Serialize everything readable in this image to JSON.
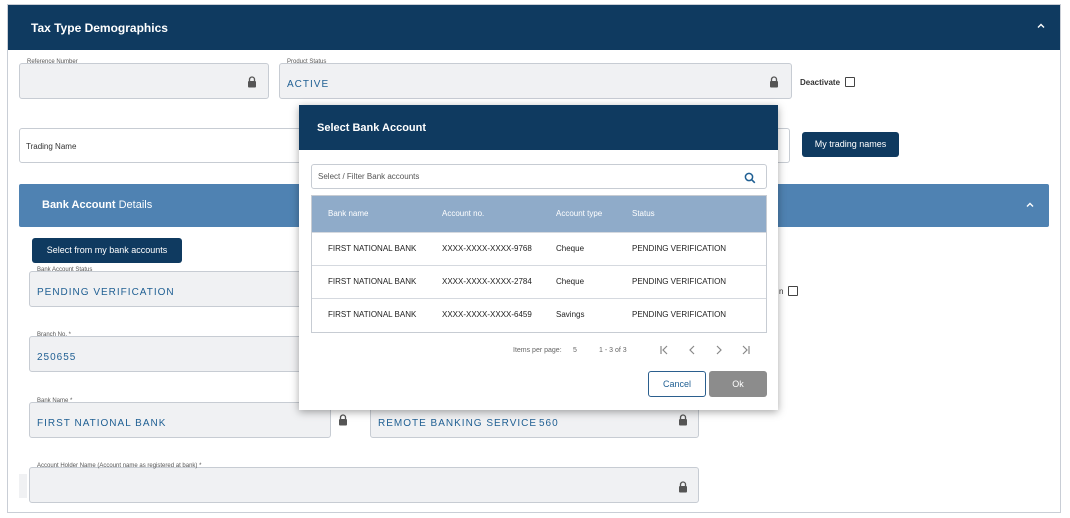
{
  "section": {
    "title": "Tax Type Demographics"
  },
  "reference_number": {
    "label": "Reference Number",
    "value": ""
  },
  "product_status": {
    "label": "Product Status",
    "value": "ACTIVE"
  },
  "deactivate": {
    "label": "Deactivate",
    "checked": false
  },
  "trading_name": {
    "label": "Trading Name"
  },
  "my_trading_names_label": "My trading names",
  "bank_section": {
    "title_bold": "Bank Account",
    "title_rest": " Details"
  },
  "select_bank_button": "Select from my bank accounts",
  "bank_account_status": {
    "label": "Bank Account Status",
    "value": "PENDING VERIFICATION"
  },
  "right_checkbox": {
    "label_fragment": "n",
    "checked": false
  },
  "branch_no": {
    "label": "Branch No. *",
    "value": "250655"
  },
  "bank_name": {
    "label": "Bank Name *",
    "value": "FIRST NATIONAL BANK"
  },
  "branch_name": {
    "value": "REMOTE BANKING SERVICE",
    "code": "560"
  },
  "account_holder": {
    "label": "Account Holder Name (Account name as registered at bank) *",
    "value": ""
  },
  "modal": {
    "title": "Select Bank Account",
    "search_placeholder": "Select / Filter Bank accounts",
    "columns": [
      "Bank name",
      "Account no.",
      "Account type",
      "Status"
    ],
    "rows": [
      {
        "bank": "FIRST NATIONAL BANK",
        "account": "XXXX-XXXX-XXXX-9768",
        "type": "Cheque",
        "status": "PENDING VERIFICATION"
      },
      {
        "bank": "FIRST NATIONAL BANK",
        "account": "XXXX-XXXX-XXXX-2784",
        "type": "Cheque",
        "status": "PENDING VERIFICATION"
      },
      {
        "bank": "FIRST NATIONAL BANK",
        "account": "XXXX-XXXX-XXXX-6459",
        "type": "Savings",
        "status": "PENDING VERIFICATION"
      }
    ],
    "items_per_page_label": "Items per page:",
    "items_per_page": "5",
    "range": "1 - 3 of 3",
    "cancel_label": "Cancel",
    "ok_label": "Ok"
  },
  "colors": {
    "header_dark": "#0f3a60",
    "header_light": "#4f82b2",
    "table_head": "#8fabc9",
    "value_text": "#1f5f93"
  }
}
